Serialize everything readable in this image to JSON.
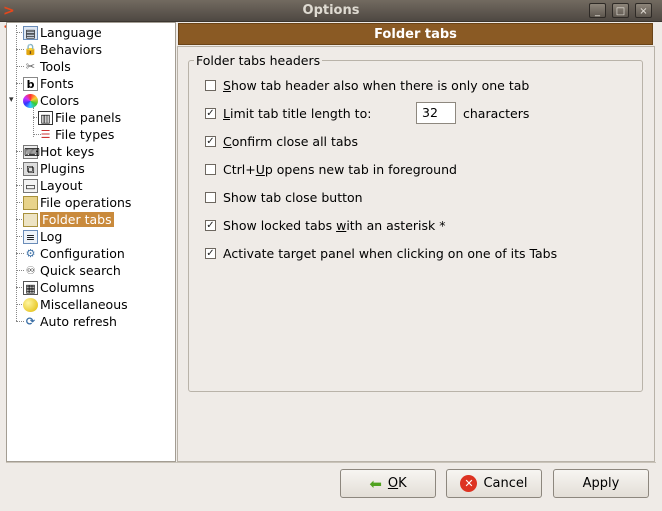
{
  "window": {
    "title": "Options",
    "controls": [
      "_",
      "□",
      "×"
    ]
  },
  "tree": {
    "items": [
      {
        "label": "Language",
        "icon": "language-icon"
      },
      {
        "label": "Behaviors",
        "icon": "lock-icon"
      },
      {
        "label": "Tools",
        "icon": "tools-icon"
      },
      {
        "label": "Fonts",
        "icon": "font-icon"
      },
      {
        "label": "Colors",
        "icon": "color-wheel-icon"
      },
      {
        "label": "File panels",
        "icon": "file-panels-icon"
      },
      {
        "label": "File types",
        "icon": "file-types-icon"
      },
      {
        "label": "Hot keys",
        "icon": "keyboard-icon"
      },
      {
        "label": "Plugins",
        "icon": "plugin-icon"
      },
      {
        "label": "Layout",
        "icon": "layout-icon"
      },
      {
        "label": "File operations",
        "icon": "file-operations-icon"
      },
      {
        "label": "Folder tabs",
        "icon": "folder-tabs-icon"
      },
      {
        "label": "Log",
        "icon": "log-icon"
      },
      {
        "label": "Configuration",
        "icon": "configuration-icon"
      },
      {
        "label": "Quick search",
        "icon": "binoculars-icon"
      },
      {
        "label": "Columns",
        "icon": "columns-icon"
      },
      {
        "label": "Miscellaneous",
        "icon": "miscellaneous-icon"
      },
      {
        "label": "Auto refresh",
        "icon": "refresh-icon"
      }
    ],
    "selected": "Folder tabs"
  },
  "panel": {
    "header": "Folder tabs",
    "group_title": "Folder tabs headers",
    "options": [
      {
        "pre": "",
        "u": "S",
        "post": "how tab header also when there is only one tab",
        "checked": false
      },
      {
        "pre": "",
        "u": "L",
        "post": "imit tab title length to:",
        "checked": true
      },
      {
        "pre": "",
        "u": "C",
        "post": "onfirm close all tabs",
        "checked": true
      },
      {
        "pre": "Ctrl+",
        "u": "U",
        "post": "p opens new tab in foreground",
        "checked": false
      },
      {
        "pre": "Show tab close button",
        "u": "",
        "post": "",
        "checked": false
      },
      {
        "pre": "Show locked tabs ",
        "u": "w",
        "post": "ith an asterisk *",
        "checked": true
      },
      {
        "pre": "Activate target panel when clicking on one of its Tabs",
        "u": "",
        "post": "",
        "checked": true
      }
    ],
    "title_length": "32",
    "title_length_unit": "characters"
  },
  "buttons": {
    "ok": {
      "u": "O",
      "rest": "K"
    },
    "cancel": "Cancel",
    "apply": "Apply"
  }
}
